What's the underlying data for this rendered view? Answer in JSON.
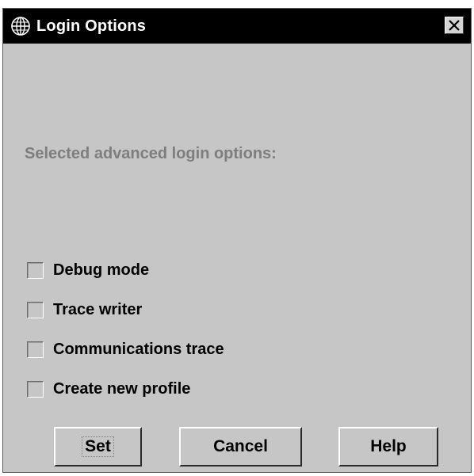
{
  "window": {
    "title": "Login Options",
    "title_icon": "globe-icon",
    "close_icon": "close-icon"
  },
  "prompt": "Selected advanced login options:",
  "options": [
    {
      "label": "Debug mode",
      "checked": false
    },
    {
      "label": "Trace writer",
      "checked": false
    },
    {
      "label": "Communications trace",
      "checked": false
    },
    {
      "label": "Create new profile",
      "checked": false
    }
  ],
  "buttons": {
    "set": "Set",
    "cancel": "Cancel",
    "help": "Help"
  },
  "colors": {
    "titlebar": "#000000",
    "dialog_background": "#c6c6c6",
    "disabled_text": "#7e7e7e"
  }
}
